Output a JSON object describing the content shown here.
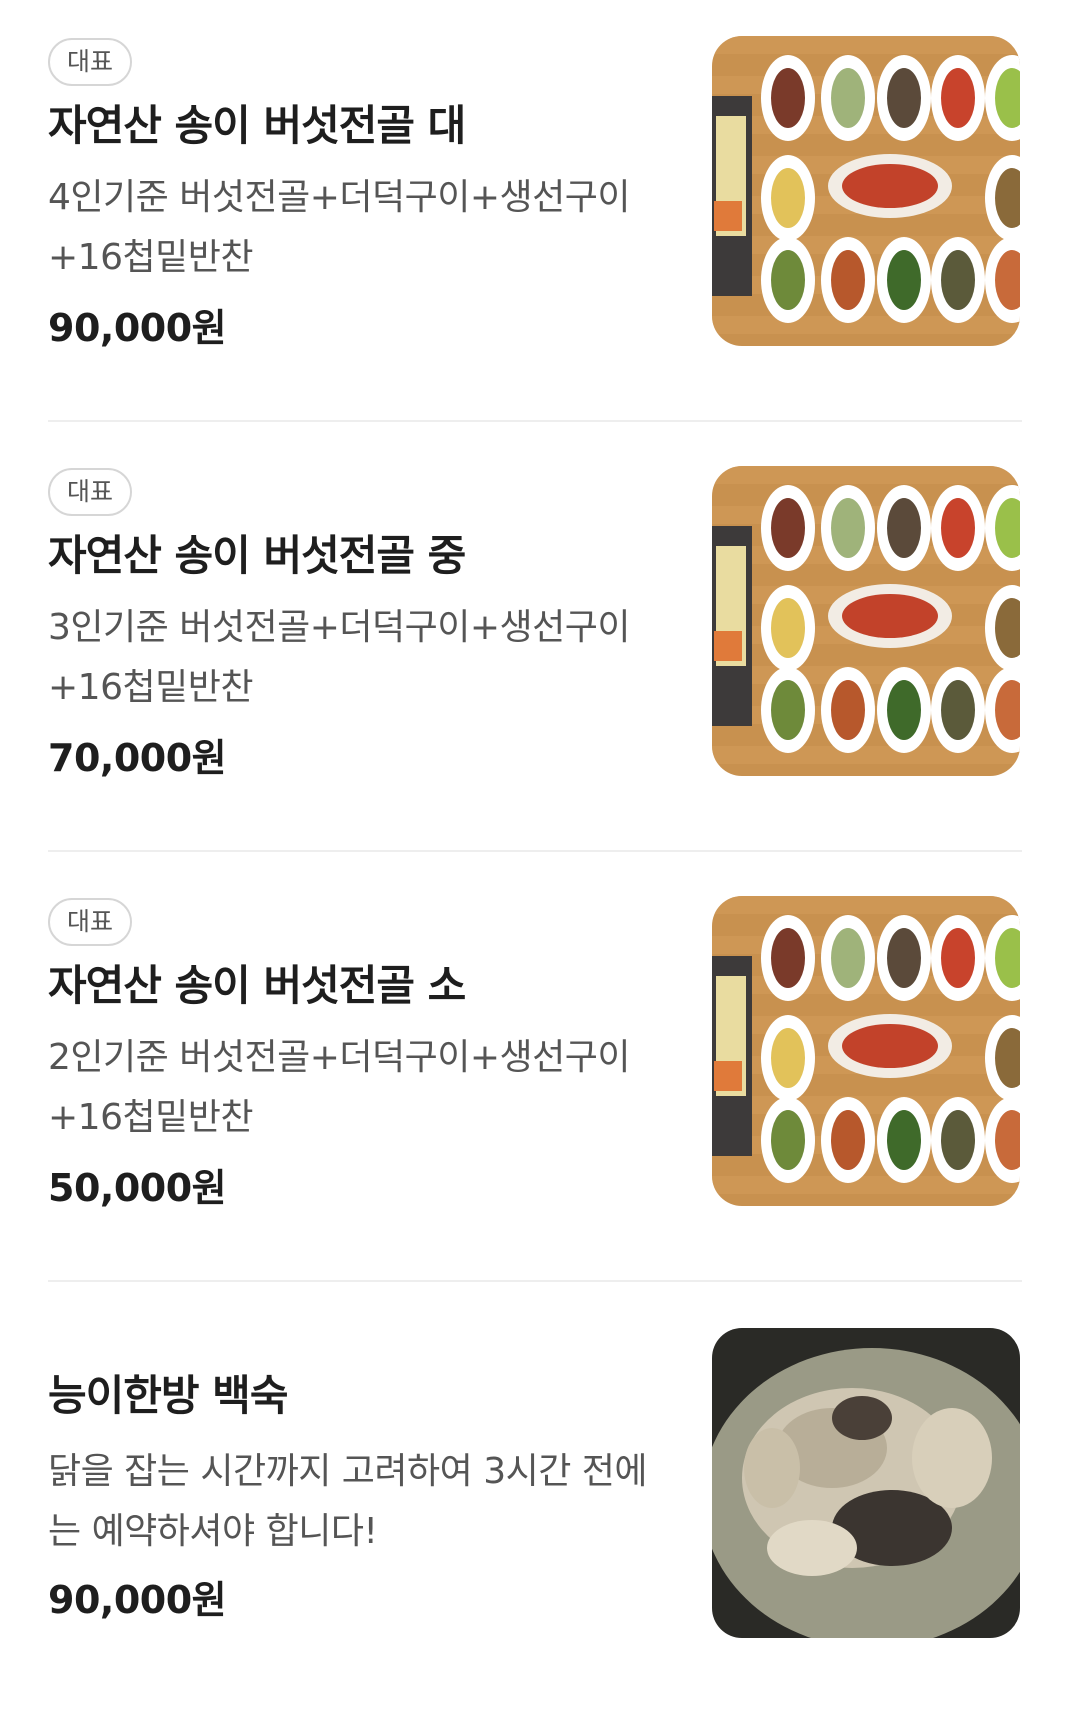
{
  "colors": {
    "badge_border": "#d6d6d6",
    "divider": "#eeeeee",
    "title": "#1e1e1e",
    "description": "#555555"
  },
  "menu_items": [
    {
      "badge": "대표",
      "title": "자연산 송이 버섯전골 대",
      "description": "4인기준 버섯전골+더덕구이+생선구이+16첩밑반찬",
      "price": "90,000원",
      "image": "banchan-spread-photo"
    },
    {
      "badge": "대표",
      "title": "자연산 송이 버섯전골 중",
      "description": "3인기준 버섯전골+더덕구이+생선구이+16첩밑반찬",
      "price": "70,000원",
      "image": "banchan-spread-photo"
    },
    {
      "badge": "대표",
      "title": "자연산 송이 버섯전골 소",
      "description": "2인기준 버섯전골+더덕구이+생선구이+16첩밑반찬",
      "price": "50,000원",
      "image": "banchan-spread-photo"
    },
    {
      "title": "능이한방 백숙",
      "description": "닭을 잡는 시간까지 고려하여 3시간 전에는 예약하셔야 합니다!",
      "price": "90,000원",
      "image": "baeksuk-photo"
    }
  ]
}
